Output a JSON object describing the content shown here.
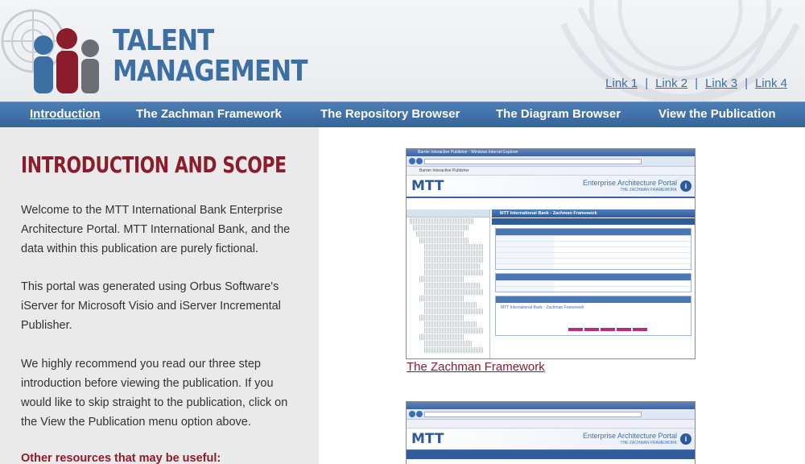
{
  "header": {
    "logo_line1": "TALENT",
    "logo_line2": "MANAGEMENT",
    "links": [
      "Link 1",
      "Link 2",
      "Link 3",
      "Link 4"
    ],
    "link_separator": "|"
  },
  "nav": {
    "items": [
      {
        "label": "Introduction",
        "active": true
      },
      {
        "label": "The Zachman Framework",
        "active": false
      },
      {
        "label": "The Repository Browser",
        "active": false
      },
      {
        "label": "The Diagram Browser",
        "active": false
      },
      {
        "label": "View the Publication",
        "active": false
      }
    ]
  },
  "content": {
    "title": "INTRODUCTION AND SCOPE",
    "paragraphs": [
      "Welcome to the MTT International Bank Enterprise Architecture Portal. MTT International Bank, and the data within this publication are purely fictional.",
      "This portal was generated using Orbus Software's iServer for Microsoft Visio and iServer Incremental Publisher.",
      "We highly recommend you read our three step introduction before viewing the publication. If you would like to skip straight to the publication, click on the View the Publication menu option above."
    ],
    "resources_heading": "Other resources that may be useful:"
  },
  "screenshots": [
    {
      "caption": "The Zachman Framework",
      "browser_title": "Barrier Interactive Publisher - Windows Internet Explorer",
      "tab_label": "Barrier Interactive Publisher",
      "logo": "MTT",
      "portal_title": "Enterprise Architecture Portal",
      "portal_subtitle": "THE ZACHMAN FRAMEWORK",
      "main_header": "MTT International Bank - Zachman Framework",
      "preview_title": "MTT International Bank - Zachman Framework"
    },
    {
      "caption": "",
      "browser_title": "",
      "tab_label": "",
      "logo": "MTT",
      "portal_title": "Enterprise Architecture Portal",
      "portal_subtitle": "THE ZACHMAN FRAMEWORK"
    }
  ],
  "colors": {
    "brand_blue": "#3e6fa3",
    "nav_blue": "#3f71a8",
    "accent_red": "#8a1c2b"
  }
}
